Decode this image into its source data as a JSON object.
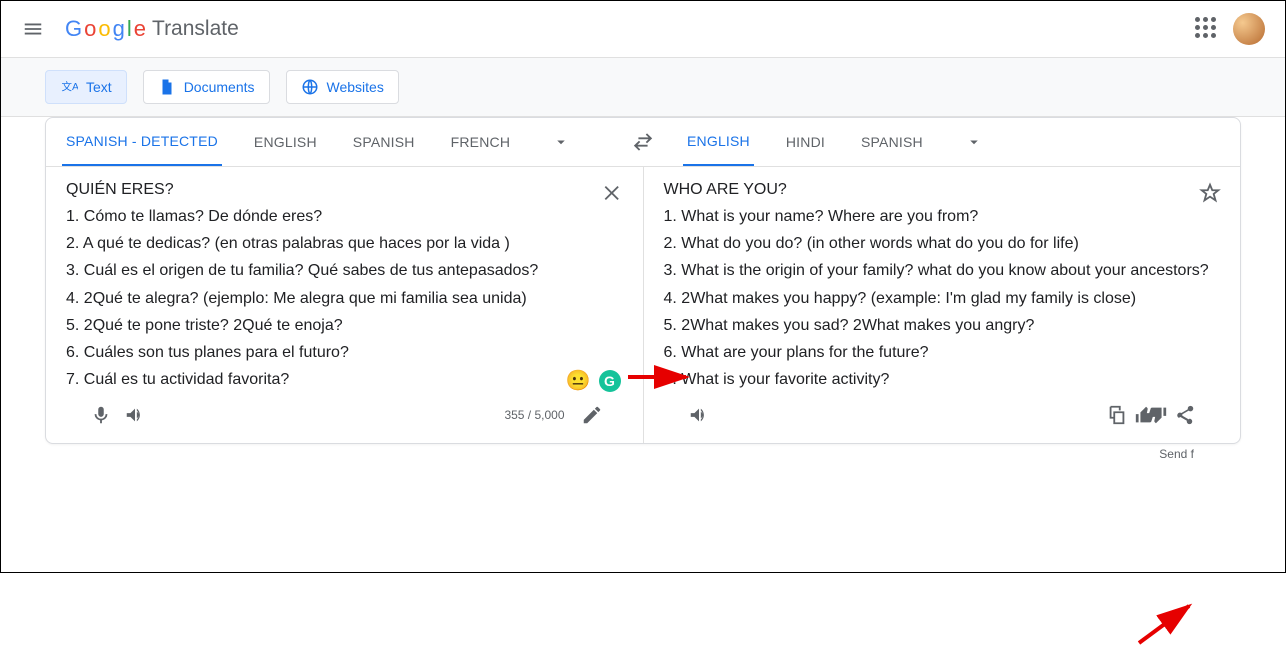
{
  "app_name": "Translate",
  "modes": {
    "text": "Text",
    "documents": "Documents",
    "websites": "Websites"
  },
  "source_langs": [
    "SPANISH - DETECTED",
    "ENGLISH",
    "SPANISH",
    "FRENCH"
  ],
  "target_langs": [
    "ENGLISH",
    "HINDI",
    "SPANISH"
  ],
  "source_active_index": 0,
  "target_active_index": 0,
  "source": {
    "title": "QUIÉN ERES?",
    "lines": [
      "1. Cómo te llamas? De dónde eres?",
      "2. A qué te dedicas? (en otras palabras que haces por la vida )",
      "3. Cuál es el origen de tu familia? Qué sabes de tus antepasados?",
      "4. 2Qué te alegra? (ejemplo: Me alegra que mi familia sea unida)",
      "5. 2Qué te pone triste? 2Qué te enoja?",
      "6. Cuáles son tus planes para el futuro?",
      "7. Cuál es tu actividad favorita?"
    ],
    "char_count": "355 / 5,000"
  },
  "target": {
    "title": "WHO ARE YOU?",
    "lines": [
      "1. What is your name? Where are you from?",
      "2. What do you do? (in other words what do you do for life)",
      "3. What is the origin of your family? what do you know about your ancestors?",
      "4. 2What makes you happy? (example: I'm glad my family is close)",
      "5. 2What makes you sad? 2What makes you angry?",
      "6. What are your plans for the future?",
      "7. What is your favorite activity?"
    ]
  },
  "footer_link": "Send f"
}
